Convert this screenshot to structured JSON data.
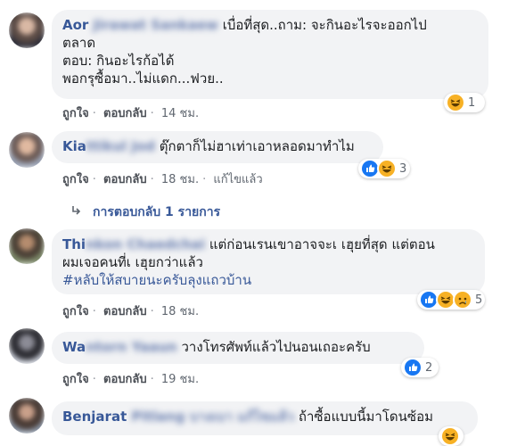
{
  "comments": [
    {
      "author_visible": "Aor",
      "author_blurred": "Jirawat Sankaew",
      "lines": [
        "เบื่อที่สุด..ถาม: จะกินอะไรจะออกไป",
        "ตลาด",
        "ตอบ: กินอะไรก้อได้",
        "พอกรุซื้อมา..ไม่แดก...ฟวย.."
      ],
      "actions": [
        "ถูกใจ",
        "ตอบกลับ",
        "14 ชม."
      ],
      "reactions": [
        "haha-icon"
      ],
      "reaction_count": "1"
    },
    {
      "author_visible": "Kia",
      "author_blurred": "ttikul Jod",
      "lines": [
        "ตุ๊กตาก็ไม่ฮาเท่าเอาหลอดมาทำไม"
      ],
      "actions": [
        "ถูกใจ",
        "ตอบกลับ",
        "18 ชม.",
        "แก้ไขแล้ว"
      ],
      "reactions": [
        "like-icon",
        "haha-icon"
      ],
      "reaction_count": "3"
    },
    {
      "author_visible": "Thi",
      "author_blurred": "nkon Chaedchai",
      "lines": [
        "แต่ก่อนเรนเขาอาจจะเ เฮุยที่สุด แต่ตอน",
        "ผมเจอคนที่เ เฮุยกว่าแล้ว"
      ],
      "hashtag": "#หลับให้สบายนะครับลุงแถวบ้าน",
      "actions": [
        "ถูกใจ",
        "ตอบกลับ",
        "18 ชม."
      ],
      "reactions": [
        "like-icon",
        "haha-icon",
        "sad-icon"
      ],
      "reaction_count": "5"
    },
    {
      "author_visible": "Wa",
      "author_blurred": "ntorn Yaaun",
      "lines": [
        "วางโทรศัพท์แล้วไปนอนเถอะครับ"
      ],
      "actions": [
        "ถูกใจ",
        "ตอบกลับ",
        "19 ชม."
      ],
      "reactions": [
        "like-icon"
      ],
      "reaction_count": "2"
    },
    {
      "author_visible": "Benjarat",
      "author_blurred": "Pitlang บางเบา แก้ไขแล้ว",
      "lines": [
        "ถ้าซื้อแบบนี้มาโดนซ้อม"
      ],
      "actions": [],
      "reactions": [
        "haha-icon"
      ],
      "reaction_count": ""
    }
  ],
  "replies_link": "การตอบกลับ 1 รายการ",
  "colors": {
    "bubble": "#f2f3f5",
    "author": "#385898",
    "meta": "#606770",
    "like": "#1877f2",
    "haha": "#f7b125"
  }
}
